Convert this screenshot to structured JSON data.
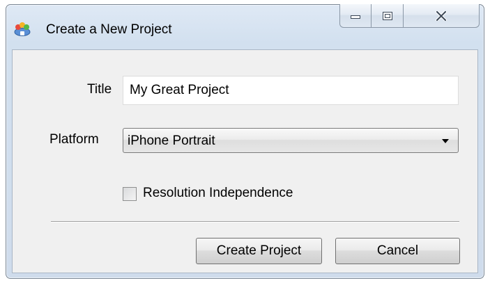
{
  "window": {
    "title": "Create a New Project",
    "app_icon": "app-tray-icon"
  },
  "caption_buttons": {
    "minimize_icon": "minimize-icon",
    "maximize_icon": "maximize-icon",
    "close_icon": "close-icon"
  },
  "form": {
    "title_label": "Title",
    "title_value": "My Great Project",
    "platform_label": "Platform",
    "platform_value": "iPhone Portrait",
    "checkbox_label": "Resolution Independence",
    "checkbox_checked": false
  },
  "buttons": {
    "create_label": "Create Project",
    "cancel_label": "Cancel"
  }
}
